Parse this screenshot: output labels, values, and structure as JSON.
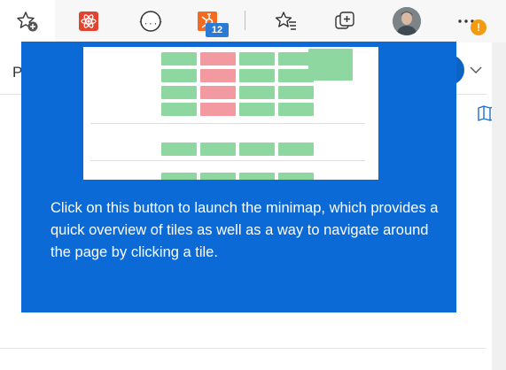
{
  "toolbar": {
    "icons": [
      "favorite-add-icon",
      "extension-react-icon",
      "extension-json-icon",
      "extension-hubspot-icon",
      "favorites-icon",
      "collections-icon",
      "profile-avatar",
      "more-icon"
    ],
    "extension_badge_count": "12",
    "alert_badge": "!"
  },
  "page": {
    "truncated_letter": "P"
  },
  "popup": {
    "message": "Click on this button to launch the minimap, which provides a quick overview of tiles as well as a way to navigate around the page by clicking a tile."
  },
  "colors": {
    "popup_background": "#0b6ad6",
    "tile_green": "#8ed7a0",
    "tile_red": "#f29aa0",
    "badge_blue": "#2b7bd6",
    "alert_orange": "#f29b11"
  }
}
